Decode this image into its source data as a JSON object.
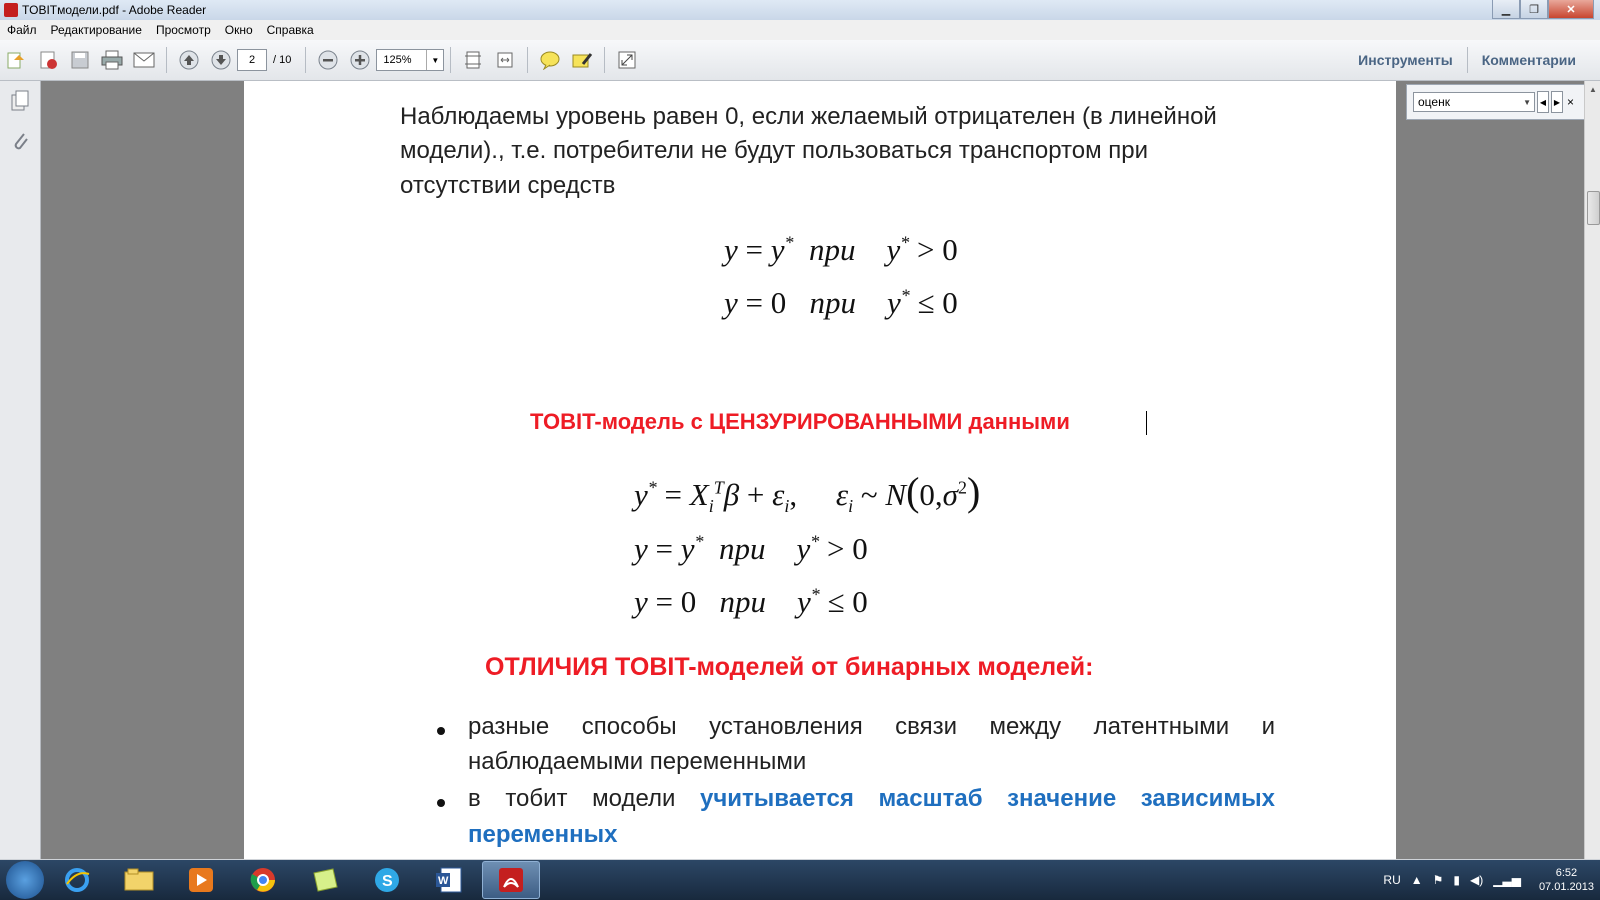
{
  "window": {
    "title": "TOBITмодели.pdf - Adobe Reader"
  },
  "menu": [
    "Файл",
    "Редактирование",
    "Просмотр",
    "Окно",
    "Справка"
  ],
  "toolbar": {
    "page_current": "2",
    "page_total": "/ 10",
    "zoom": "125%",
    "tools_label": "Инструменты",
    "comments_label": "Комментарии"
  },
  "find": {
    "query": "оценк"
  },
  "document": {
    "para1_line1": "Наблюдаемы уровень равен 0, если желаемый отрицателен (в линейной",
    "para1_line2": "модели)., т.е. потребители не будут пользоваться транспортом при",
    "para1_line3": "отсутствии средств",
    "heading1": "TOBIT-модель с ЦЕНЗУРИРОВАННЫМИ данными",
    "heading2": "ОТЛИЧИЯ TOBIT-моделей от бинарных моделей:",
    "bullet1_line1": [
      "разные",
      "способы",
      "установления",
      "связи",
      "между",
      "латентными",
      "и"
    ],
    "bullet1_line2": "наблюдаемыми переменными",
    "bullet2_prefix": [
      "в",
      "тобит",
      "модели"
    ],
    "bullet2_highlight": [
      "учитывается",
      "масштаб",
      "значение",
      "зависимых"
    ],
    "bullet2_line2": "переменных"
  },
  "taskbar": {
    "lang": "RU",
    "time": "6:52",
    "date": "07.01.2013"
  }
}
